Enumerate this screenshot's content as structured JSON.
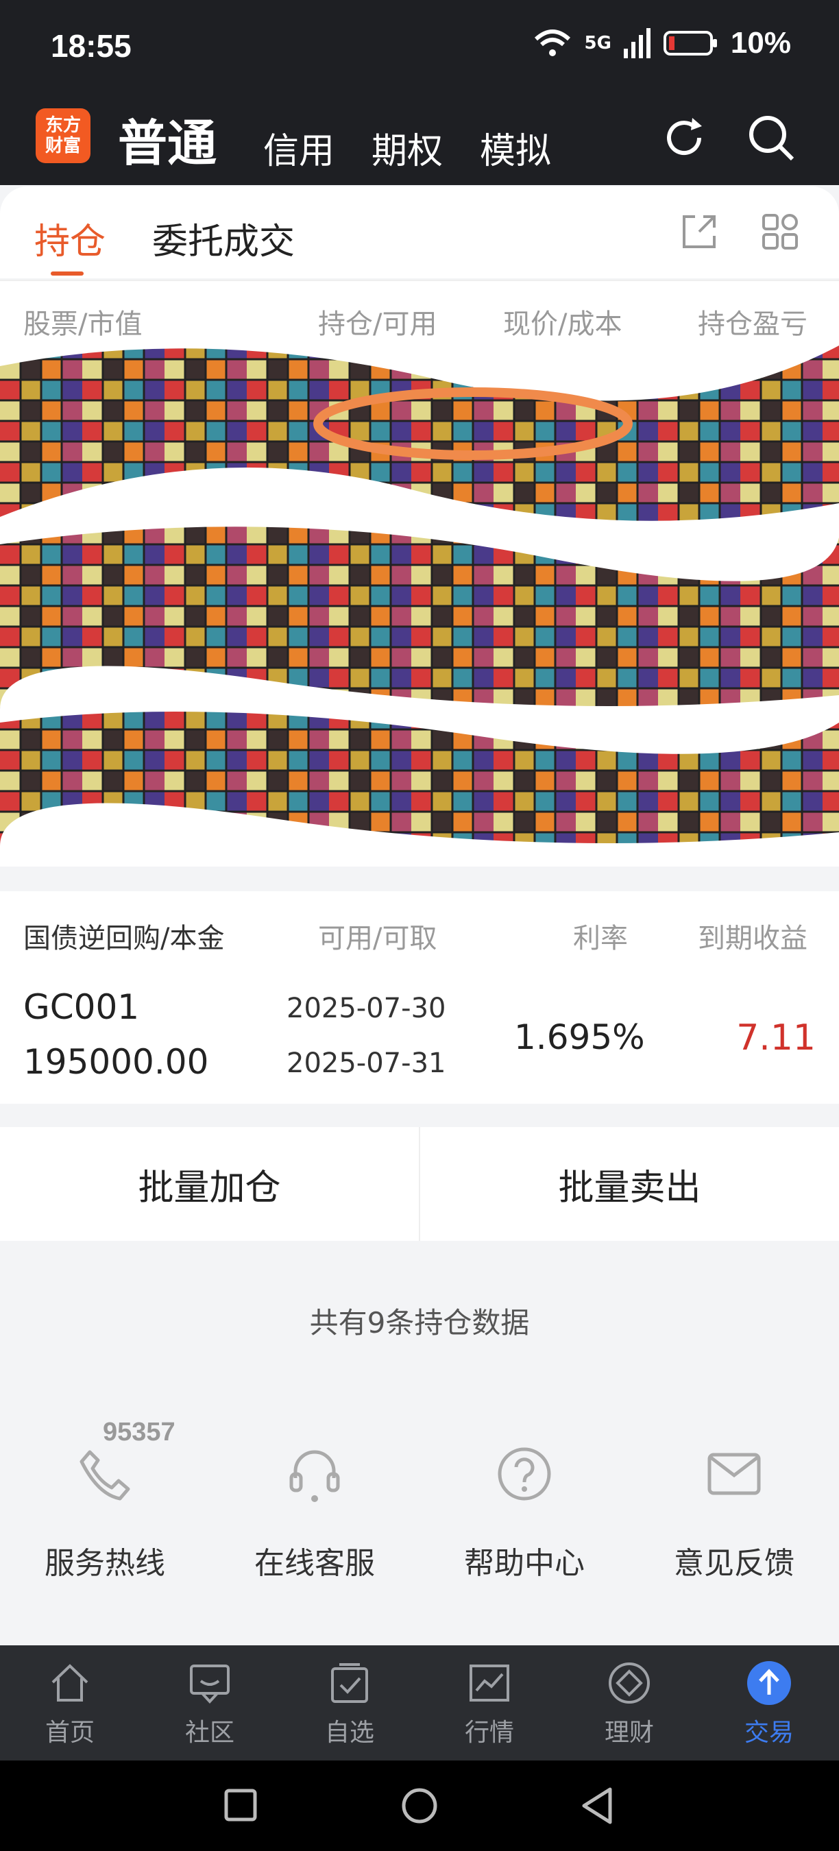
{
  "status": {
    "time": "18:55",
    "net": "5G",
    "battery": "10%"
  },
  "header": {
    "logo_top": "东方",
    "logo_bottom": "财富",
    "tabs": [
      "普通",
      "信用",
      "期权",
      "模拟"
    ]
  },
  "content_tabs": [
    "持仓",
    "委托成交"
  ],
  "columns": [
    "股票/市值",
    "持仓/可用",
    "现价/成本",
    "持仓盈亏"
  ],
  "bond": {
    "headers": [
      "国债逆回购/本金",
      "可用/可取",
      "利率",
      "到期收益"
    ],
    "code": "GC001",
    "principal": "195000.00",
    "date_available": "2025-07-30",
    "date_withdraw": "2025-07-31",
    "rate": "1.695%",
    "profit": "7.11"
  },
  "actions": [
    "批量加仓",
    "批量卖出"
  ],
  "count_text": "共有9条持仓数据",
  "services": [
    {
      "label": "服务热线",
      "icon": "phone-icon",
      "number": "95357"
    },
    {
      "label": "在线客服",
      "icon": "headset-icon"
    },
    {
      "label": "帮助中心",
      "icon": "help-icon"
    },
    {
      "label": "意见反馈",
      "icon": "mail-icon"
    }
  ],
  "tabbar": [
    "首页",
    "社区",
    "自选",
    "行情",
    "理财",
    "交易"
  ],
  "colors": {
    "accent": "#e85b2b",
    "profit_red": "#d0322b",
    "tab_active": "#3d7cf0"
  }
}
